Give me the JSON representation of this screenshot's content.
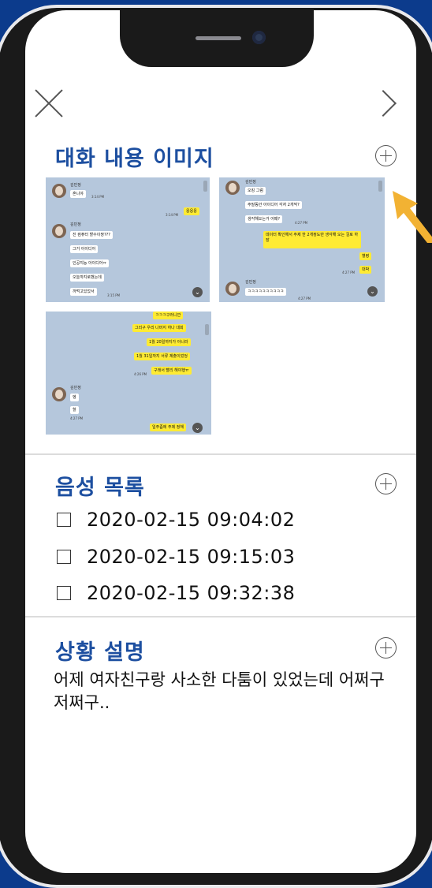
{
  "header": {
    "close_icon": "close-icon",
    "next_icon": "chevron-right-icon"
  },
  "images_section": {
    "title": "대화 내용 이미지",
    "add_icon": "plus-circle-icon",
    "thumbnails": [
      {
        "contact": "김민정",
        "messages": [
          {
            "side": "left",
            "text": "혼니야"
          },
          {
            "side": "time",
            "text": "3:14 PM"
          },
          {
            "side": "right",
            "text": "응응응"
          },
          {
            "side": "time",
            "text": "3:14 PM"
          },
          {
            "side": "left",
            "text": "진 컴퓨터 할수이쌍???"
          },
          {
            "side": "left",
            "text": "그거 아이디어"
          },
          {
            "side": "left",
            "text": "인공지능 아이디어ㅠ"
          },
          {
            "side": "left",
            "text": "오늘까지로했는데"
          },
          {
            "side": "left",
            "text": "까먹고있었서"
          },
          {
            "side": "time",
            "text": "3:15 PM"
          }
        ]
      },
      {
        "contact": "김민정",
        "messages": [
          {
            "side": "left",
            "text": "오킹 그럼"
          },
          {
            "side": "left",
            "text": "주말동안 아이디어 각자 2개씩?"
          },
          {
            "side": "left",
            "text": "생각해오는거 어때?"
          },
          {
            "side": "time",
            "text": "4:27 PM"
          },
          {
            "side": "right",
            "text": "데이터 확인해서 주제 한 2개정도만 생각해 오는 걸로 하장"
          },
          {
            "side": "right",
            "text": "혈령"
          },
          {
            "side": "right",
            "text": "대박"
          },
          {
            "side": "time",
            "text": "4:27 PM"
          },
          {
            "side": "left",
            "text": "ㅋㅋㅋㅋㅋㅋㅋㅋㅋㅋ"
          },
          {
            "side": "time",
            "text": "4:27 PM"
          }
        ]
      },
      {
        "contact": "김민정",
        "messages": [
          {
            "side": "right",
            "text": "ㅋㅋㅋ구러니깐"
          },
          {
            "side": "right",
            "text": "그리구 우리 나머지 하나 대회"
          },
          {
            "side": "right",
            "text": "1월 20일까지가 아니라"
          },
          {
            "side": "right",
            "text": "1월 31일까지 서류 제출이었엉"
          },
          {
            "side": "right",
            "text": "구래서 빨리 해야행ㅠ"
          },
          {
            "side": "time",
            "text": "4:26 PM"
          },
          {
            "side": "left",
            "text": "엥"
          },
          {
            "side": "left",
            "text": "헐"
          },
          {
            "side": "time",
            "text": "4:27 PM"
          },
          {
            "side": "right",
            "text": "일주좀에 주제 정해"
          }
        ]
      }
    ]
  },
  "voice_section": {
    "title": "음성 목록",
    "add_icon": "plus-circle-icon",
    "items": [
      {
        "label": "2020-02-15  09:04:02",
        "checked": false
      },
      {
        "label": "2020-02-15  09:15:03",
        "checked": false
      },
      {
        "label": "2020-02-15  09:32:38",
        "checked": false
      }
    ]
  },
  "situation_section": {
    "title": "상황 설명",
    "add_icon": "plus-circle-icon",
    "description": "어제 여자친구랑 사소한 다툼이 있었는데 어쩌구 저쩌구.."
  },
  "colors": {
    "background": "#0c3b8c",
    "title": "#1d4fa0",
    "chat_bg": "#b5c7dc",
    "bubble_yellow": "#ffeb33",
    "arrow": "#f2b233"
  }
}
